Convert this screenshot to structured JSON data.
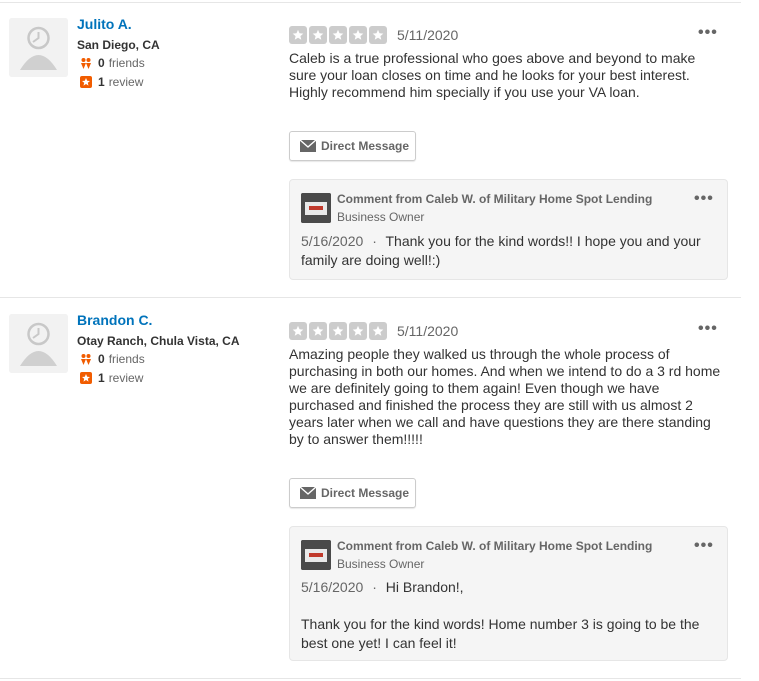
{
  "reviews": [
    {
      "user": {
        "name": "Julito A.",
        "location": "San Diego, CA",
        "friends_count": "0",
        "friends_label": "friends",
        "reviews_count": "1",
        "reviews_label": "review"
      },
      "rating": 5,
      "date": "5/11/2020",
      "text": "Caleb is a true professional who goes above and beyond to make sure your loan closes on time and he looks for your best interest. Highly recommend him specially if you use your VA loan.",
      "direct_message_label": "Direct Message",
      "comment": {
        "title": "Comment from Caleb W. of Military Home Spot Lending",
        "role": "Business Owner",
        "date": "5/16/2020",
        "separator": "·",
        "text": "Thank you for the kind words!! I hope you and your family are doing well!:)"
      }
    },
    {
      "user": {
        "name": "Brandon C.",
        "location": "Otay Ranch, Chula Vista, CA",
        "friends_count": "0",
        "friends_label": "friends",
        "reviews_count": "1",
        "reviews_label": "review"
      },
      "rating": 5,
      "date": "5/11/2020",
      "text": "Amazing people they walked us through the whole process of purchasing in both our homes. And when we intend to do a 3 rd home we are definitely going to them again! Even though we have purchased and finished the process they are still with us almost 2 years later when we call and have questions they are there standing by to answer them!!!!!",
      "direct_message_label": "Direct Message",
      "comment": {
        "title": "Comment from Caleb W. of Military Home Spot Lending",
        "role": "Business Owner",
        "date": "5/16/2020",
        "separator": "·",
        "text": "Hi Brandon!,",
        "text2": "Thank you for the kind words! Home number 3 is going to be the best one yet! I can feel it!"
      }
    }
  ],
  "more_label": "•••",
  "colors": {
    "star_empty": "#cccccc",
    "link": "#0073bb",
    "review_icon": "#f15c00",
    "friends_icon": "#f15c00"
  }
}
